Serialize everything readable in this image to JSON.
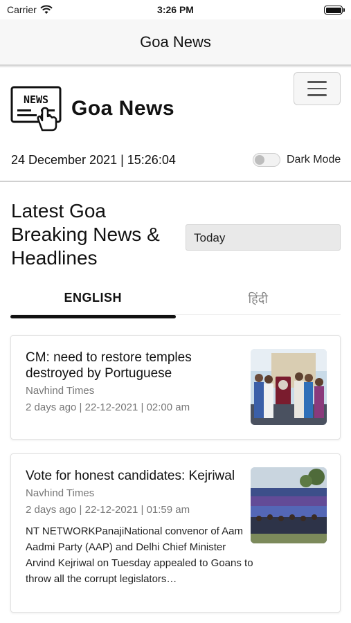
{
  "status_bar": {
    "carrier": "Carrier",
    "time": "3:26 PM"
  },
  "nav": {
    "title": "Goa News"
  },
  "site": {
    "logo_badge": "NEWS",
    "logo_text": "Goa News",
    "datetime": "24 December 2021 | 15:26:04",
    "dark_mode_label": "Dark Mode",
    "dark_mode_on": false
  },
  "section": {
    "headline": "Latest Goa Breaking News & Headlines",
    "filter_value": "Today"
  },
  "tabs": [
    {
      "label": "ENGLISH",
      "active": true
    },
    {
      "label": "हिंदी",
      "active": false
    }
  ],
  "articles": [
    {
      "title": "CM: need to restore temples destroyed by Portuguese",
      "source": "Navhind Times",
      "meta": "2 days ago | 22-12-2021 | 02:00 am",
      "excerpt": ""
    },
    {
      "title": "Vote for honest candidates: Kejriwal",
      "source": "Navhind Times",
      "meta": "2 days ago | 22-12-2021 | 01:59 am",
      "excerpt": "NT NETWORKPanajiNational convenor of Aam Aadmi Party (AAP) and Delhi Chief Minister Arvind Kejriwal on Tuesday appealed to Goans to throw all the corrupt legislators…"
    }
  ]
}
